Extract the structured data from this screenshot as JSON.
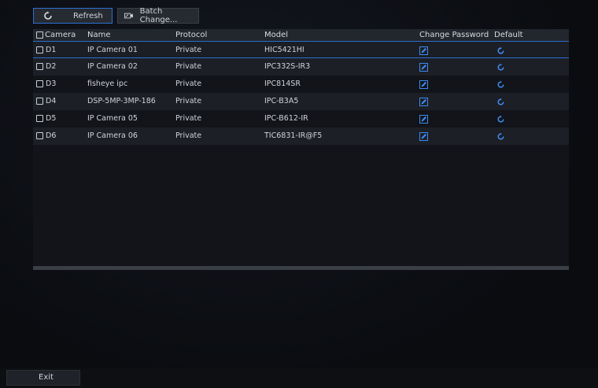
{
  "toolbar": {
    "refresh_label": "Refresh",
    "batch_label": "Batch Change..."
  },
  "table": {
    "headers": {
      "camera": "Camera",
      "name": "Name",
      "protocol": "Protocol",
      "model": "Model",
      "change_password": "Change Password",
      "default": "Default"
    },
    "rows": [
      {
        "camera": "D1",
        "name": "IP Camera 01",
        "protocol": "Private",
        "model": "HIC5421HI"
      },
      {
        "camera": "D2",
        "name": "IP Camera 02",
        "protocol": "Private",
        "model": "IPC332S-IR3"
      },
      {
        "camera": "D3",
        "name": "fisheye ipc",
        "protocol": "Private",
        "model": "IPC814SR"
      },
      {
        "camera": "D4",
        "name": "DSP-5MP-3MP-186",
        "protocol": "Private",
        "model": "IPC-B3A5"
      },
      {
        "camera": "D5",
        "name": "IP Camera 05",
        "protocol": "Private",
        "model": "IPC-B612-IR"
      },
      {
        "camera": "D6",
        "name": "IP Camera 06",
        "protocol": "Private",
        "model": "TIC6831-IR@F5"
      }
    ],
    "selected_row": "D1",
    "icons": {
      "change_password": "edit-icon",
      "default": "restore-default-icon"
    }
  },
  "footer": {
    "exit_label": "Exit"
  },
  "colors": {
    "accent": "#2c6fd2",
    "icon_blue": "#3d8bf0"
  }
}
